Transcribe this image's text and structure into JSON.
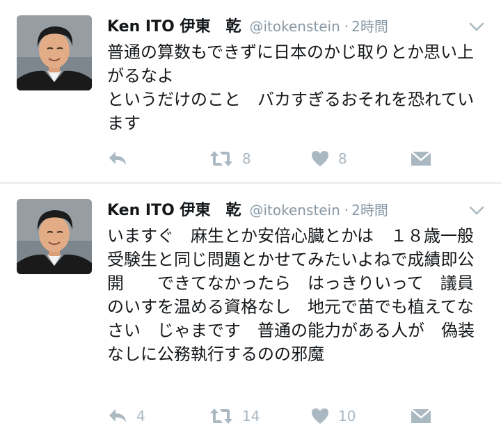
{
  "tweets": [
    {
      "name": "Ken ITO 伊東　乾",
      "handle": "@itokenstein",
      "separator": "·",
      "time": "2時間",
      "text": "普通の算数もできずに日本のかじ取りとか思い上がるなよ\nというだけのこと　バカすぎるおそれを恐れています",
      "replies": "",
      "retweets": "8",
      "likes": "8"
    },
    {
      "name": "Ken ITO 伊東　乾",
      "handle": "@itokenstein",
      "separator": "·",
      "time": "2時間",
      "text": "いますぐ　麻生とか安倍心臓とかは　１８歳一般受験生と同じ問題とかせてみたいよねで成績即公開　　できてなかったら　はっきりいって　議員のいすを温める資格なし　地元で苗でも植えてなさい　じゃまです　普通の能力がある人が　偽装なしに公務執行するのの邪魔",
      "replies": "4",
      "retweets": "14",
      "likes": "10"
    }
  ],
  "icons": {
    "reply": "reply-icon",
    "retweet": "retweet-icon",
    "like": "heart-icon",
    "dm": "envelope-icon",
    "caret": "chevron-down-icon"
  },
  "colors": {
    "icon_gray": "#aab8c2",
    "secondary_text": "#8899a6",
    "divider": "#e6ecf0"
  }
}
